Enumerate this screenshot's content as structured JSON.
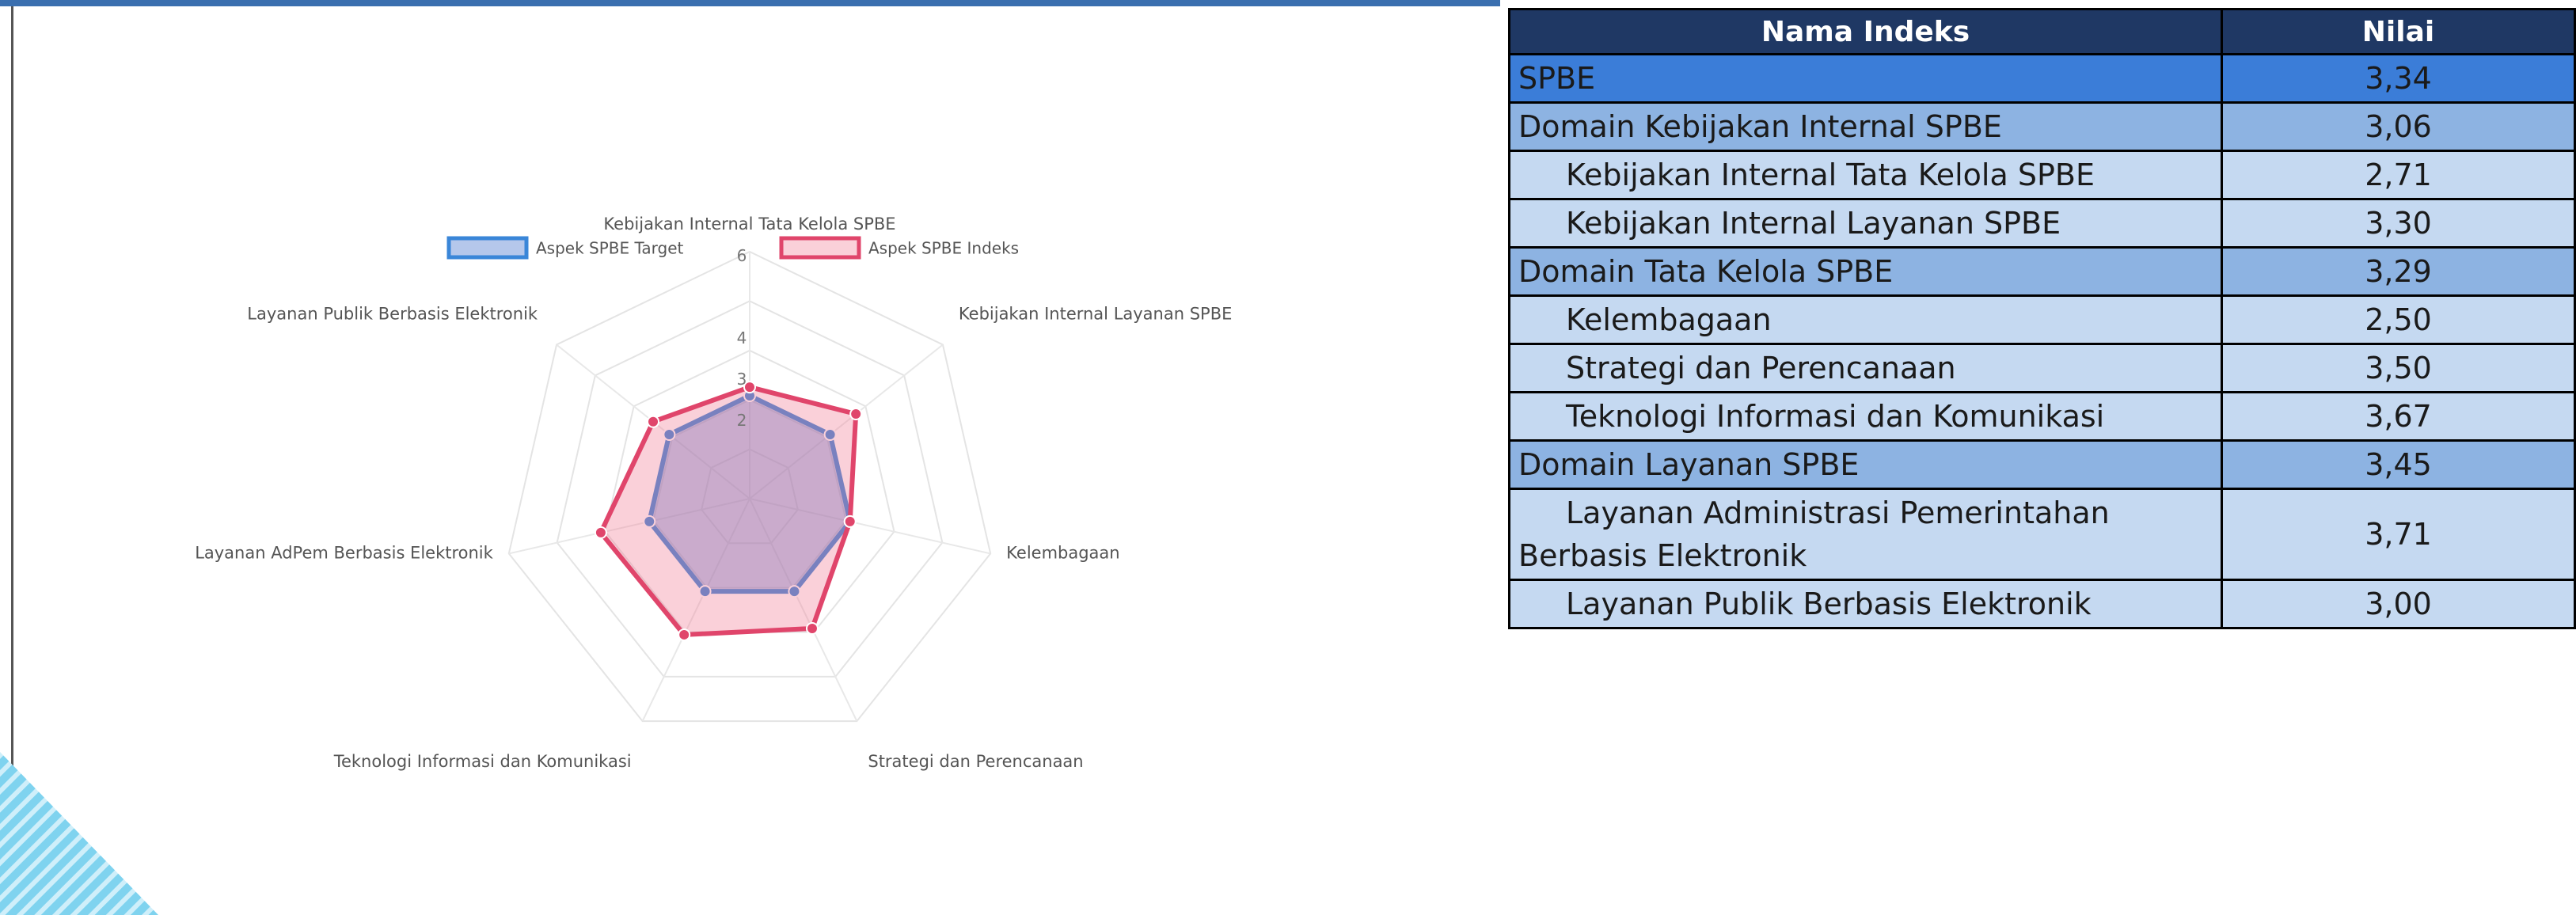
{
  "chart_data": {
    "type": "radar",
    "axes": [
      "Kebijakan Internal Tata Kelola SPBE",
      "Kebijakan Internal Layanan SPBE",
      "Kelembagaan",
      "Strategi dan Perencanaan",
      "Teknologi Informasi dan Komunikasi",
      "Layanan AdPem Berbasis Elektronik",
      "Layanan Publik Berbasis Elektronik"
    ],
    "ticks": [
      "2",
      "3",
      "4",
      "6"
    ],
    "rmax": 6,
    "grid": true,
    "legend_position": "top",
    "series": [
      {
        "name": "Aspek SPBE Target",
        "color": "#3a86d8",
        "fill": "rgba(90,130,210,0.45)",
        "values": [
          2.5,
          2.5,
          2.5,
          2.5,
          2.5,
          2.5,
          2.5
        ]
      },
      {
        "name": "Aspek SPBE Indeks",
        "color": "#e0456b",
        "fill": "rgba(240,120,145,0.35)",
        "values": [
          2.71,
          3.3,
          2.5,
          3.5,
          3.67,
          3.71,
          3.0
        ]
      }
    ]
  },
  "table": {
    "headers": [
      "Nama Indeks",
      "Nilai"
    ],
    "rows": [
      {
        "level": "total",
        "name": "SPBE",
        "value": "3,34"
      },
      {
        "level": "domain",
        "name": "Domain Kebijakan Internal SPBE",
        "value": "3,06"
      },
      {
        "level": "sub",
        "name": "Kebijakan Internal Tata Kelola SPBE",
        "value": "2,71"
      },
      {
        "level": "sub",
        "name": "Kebijakan Internal Layanan SPBE",
        "value": "3,30"
      },
      {
        "level": "domain",
        "name": "Domain Tata Kelola SPBE",
        "value": "3,29"
      },
      {
        "level": "sub",
        "name": "Kelembagaan",
        "value": "2,50"
      },
      {
        "level": "sub",
        "name": "Strategi dan Perencanaan",
        "value": "3,50"
      },
      {
        "level": "sub",
        "name": "Teknologi Informasi dan Komunikasi",
        "value": "3,67"
      },
      {
        "level": "domain",
        "name": "Domain Layanan SPBE",
        "value": "3,45"
      },
      {
        "level": "sub",
        "name": "Layanan Administrasi Pemerintahan Berbasis Elektronik",
        "value": "3,71"
      },
      {
        "level": "sub",
        "name": "Layanan Publik Berbasis Elektronik",
        "value": "3,00"
      }
    ]
  }
}
